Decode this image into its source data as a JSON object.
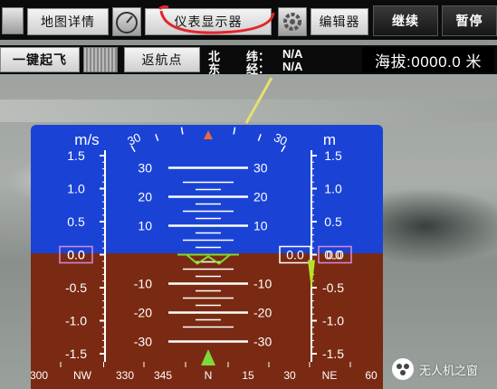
{
  "top_bar": {
    "map_details_label": "地图详情",
    "instrument_display_label": "仪表显示器",
    "editor_label": "编辑器",
    "continue_label": "继续",
    "pause_label": "暂停"
  },
  "second_bar": {
    "takeoff_label": "一键起飞",
    "return_label": "返航点",
    "gps": {
      "north_label": "北",
      "east_label": "东",
      "lat_label": "纬：",
      "lon_label": "经：",
      "lat_value": "N/A",
      "lon_value": "N/A"
    },
    "altitude_text": "海拔:0000.0 米"
  },
  "hud": {
    "speed_unit": "m/s",
    "alt_unit": "m",
    "speed_ticks": [
      "1.5",
      "1.0",
      "0.5",
      "0.0",
      "-0.5",
      "-1.0",
      "-1.5"
    ],
    "alt_ticks": [
      "1.5",
      "1.0",
      "0.5",
      "0.0",
      "-0.5",
      "-1.0",
      "-1.5"
    ],
    "speed_value": "0.0",
    "alt_value": "0.0",
    "pitch_labels": [
      "30",
      "20",
      "10",
      "-10",
      "-20",
      "-30"
    ],
    "roll_labels": [
      "30",
      "30"
    ],
    "heading_labels": [
      "300",
      "NW",
      "330",
      "345",
      "N",
      "15",
      "30",
      "NE",
      "60"
    ],
    "colors": {
      "sky": "#1a43d6",
      "ground": "#7a2a12",
      "horizon": "#7fd93a",
      "marker": "#e0a020",
      "vsi": "#b8e028"
    }
  },
  "watermark": {
    "text": "无人机之窗"
  }
}
